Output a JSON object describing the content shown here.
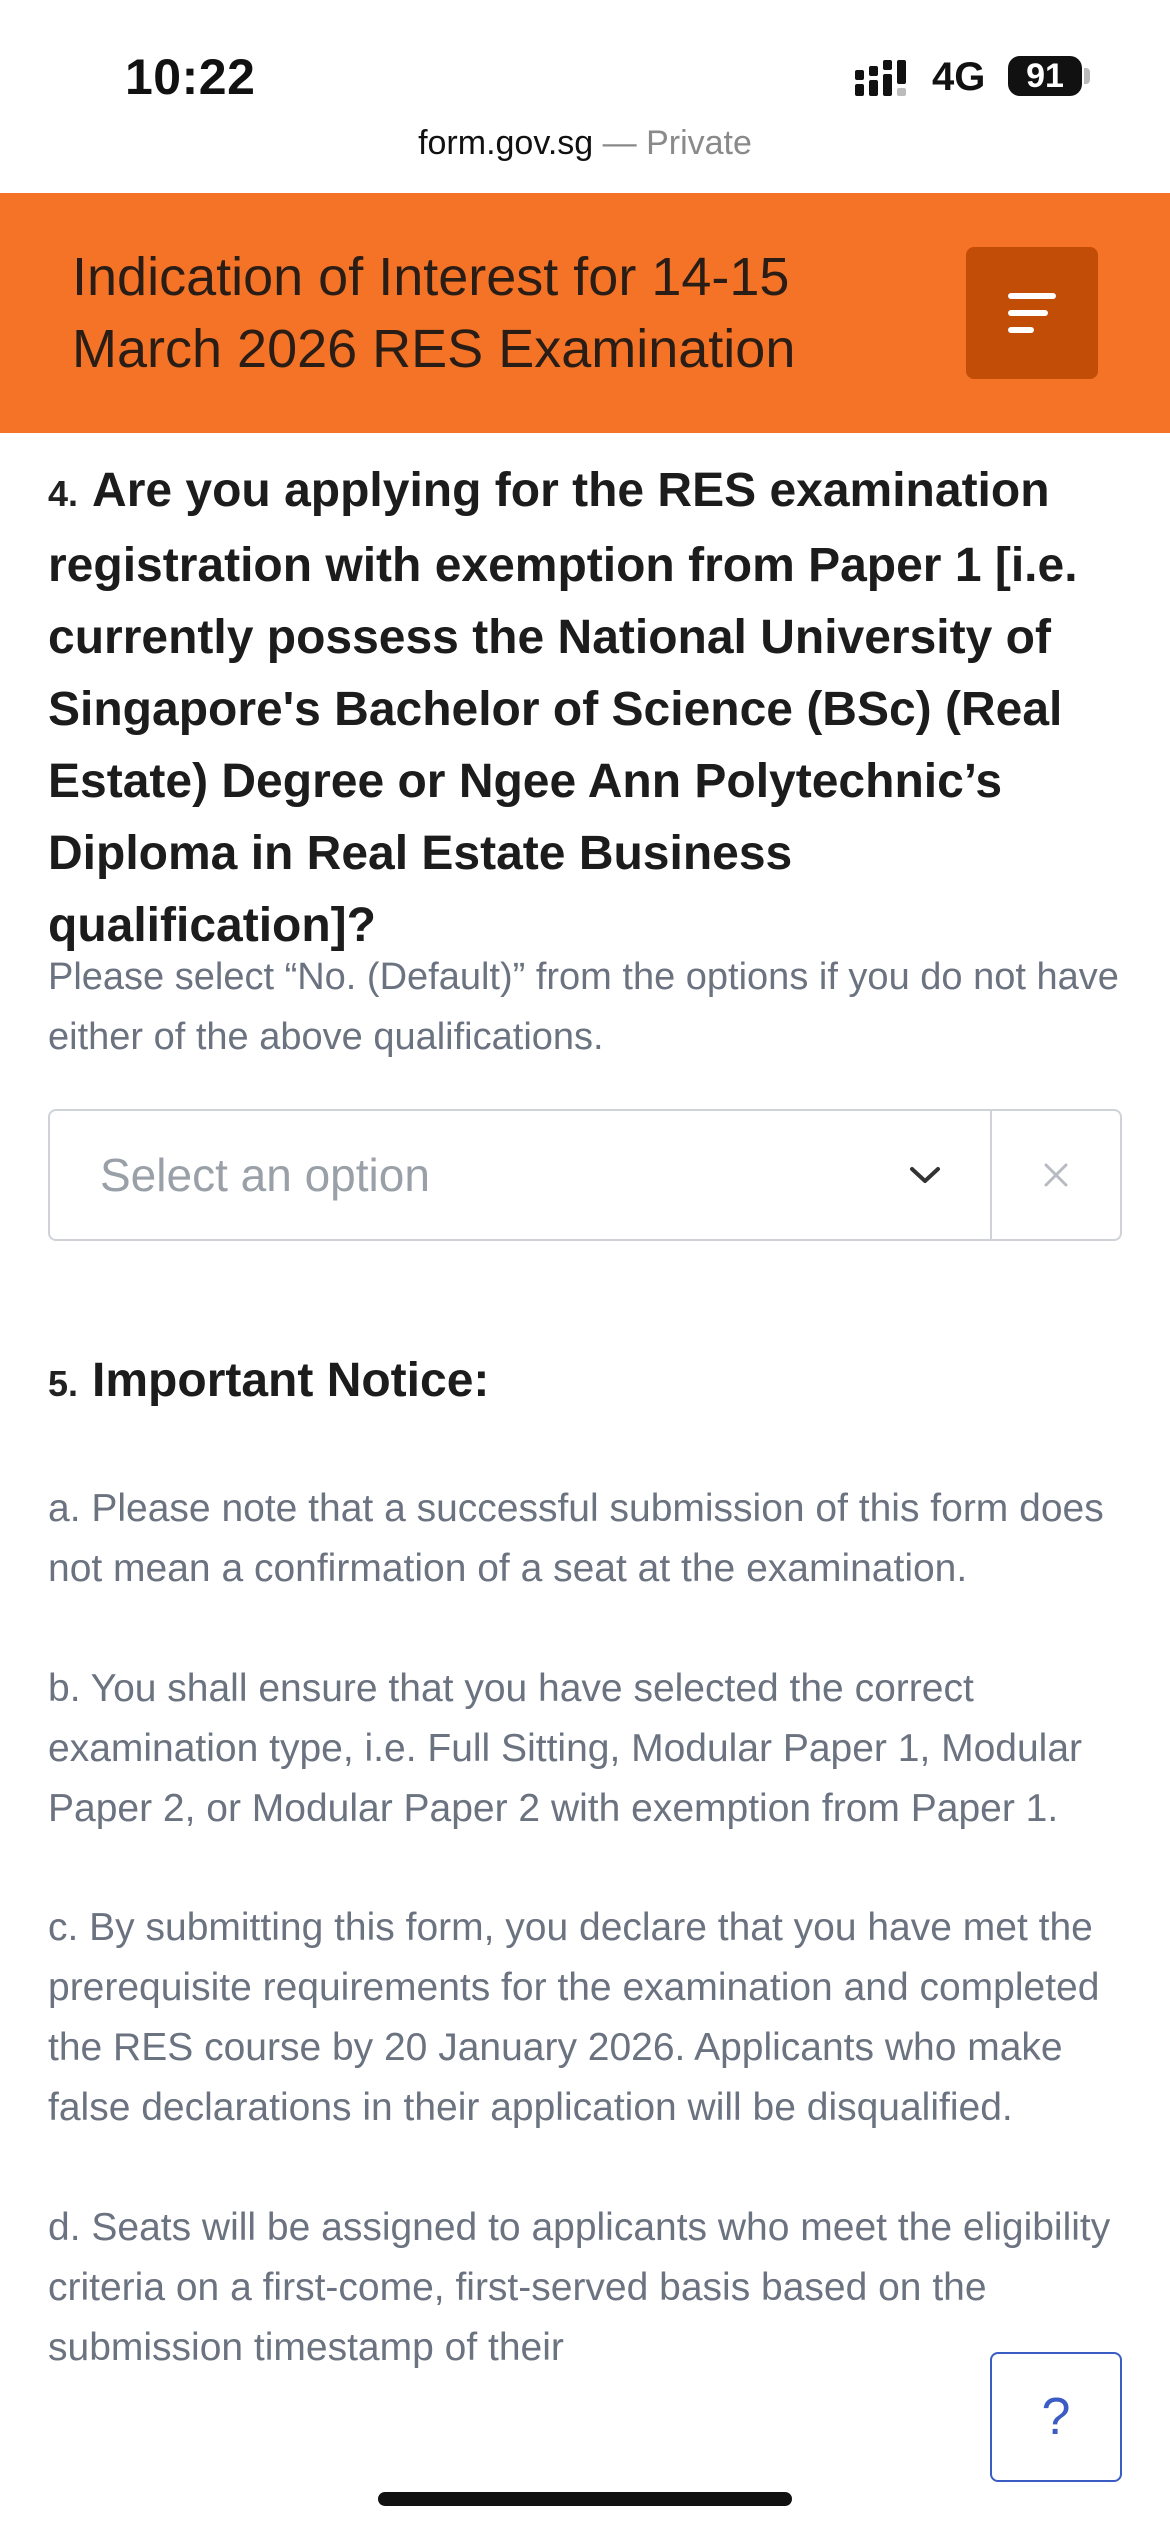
{
  "status_bar": {
    "time": "10:22",
    "network": "4G",
    "battery": "91"
  },
  "url_bar": {
    "domain": "form.gov.sg",
    "separator": " — Private"
  },
  "header": {
    "title": "Indication of Interest for 14-15 March 2026 RES Examination",
    "accent_color": "#f57326",
    "menu_button_color": "#c24d06"
  },
  "question4": {
    "number": "4.",
    "title": "Are you applying for the RES examination registration with exemption from Paper 1 [i.e. currently possess the National University of Singapore's Bachelor of Science (BSc) (Real Estate) Degree or Ngee Ann Polytechnic’s Diploma in Real Estate Business qualification]?",
    "description": "Please select “No. (Default)” from the options if you do not have either of the above qualifications.",
    "select_placeholder": "Select an option"
  },
  "question5": {
    "number": "5.",
    "title": "Important Notice:",
    "paragraphs": [
      "a. Please note that a successful submission of this form does not mean a confirmation of a seat at the examination.",
      "b. You shall ensure that you have selected the correct examination type, i.e. Full Sitting, Modular Paper 1, Modular Paper 2, or Modular Paper 2 with exemption from Paper 1.",
      "c. By submitting this form, you declare that you have met the prerequisite requirements for the examination and completed the RES course by 20 January 2026. Applicants who make false declarations in their application will be disqualified.",
      "d. Seats will be assigned to applicants who meet the eligibility criteria on a first-come, first-served basis based on the submission timestamp of their"
    ]
  },
  "help_button": {
    "label": "?",
    "color": "#3b5cc4"
  },
  "icons": [
    "signal-icon",
    "battery-icon",
    "menu-icon",
    "chevron-down-icon",
    "close-icon",
    "help-icon"
  ]
}
